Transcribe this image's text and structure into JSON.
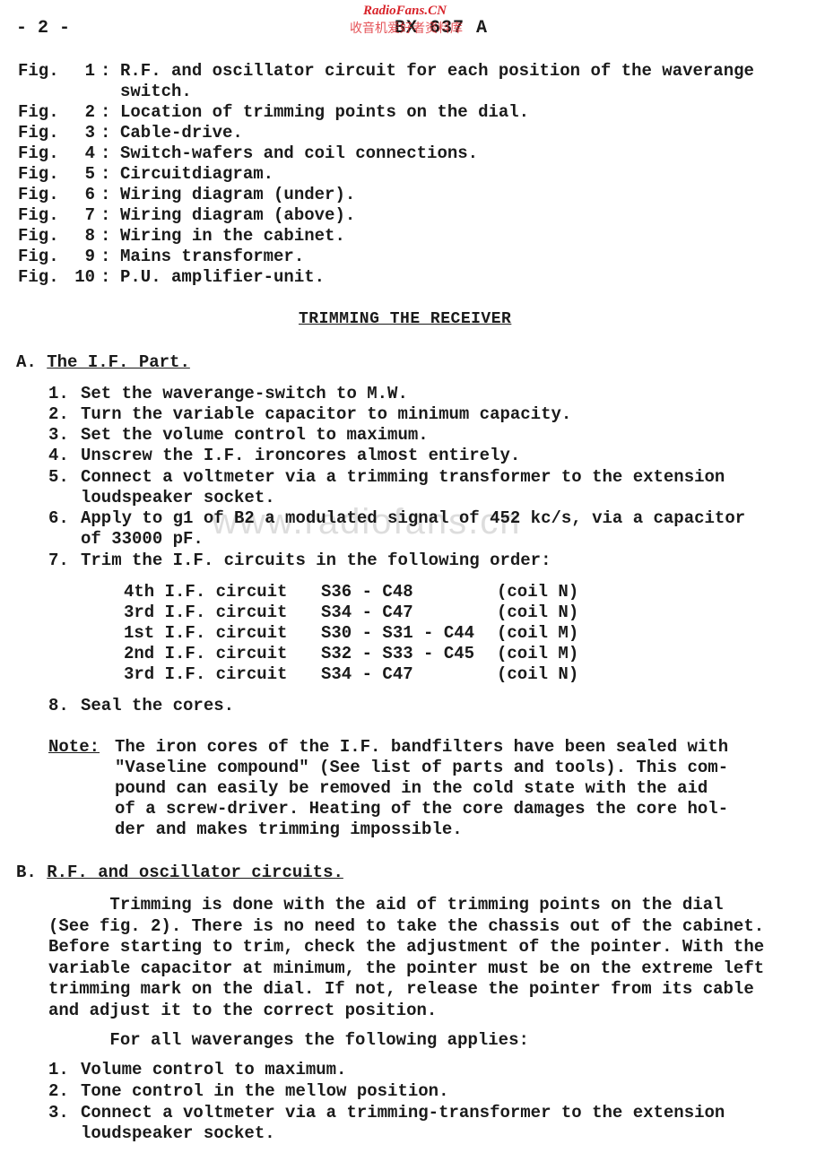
{
  "header": {
    "page_number": "- 2 -",
    "document_code": "BX 637 A",
    "watermark_top": "RadioFans.CN",
    "watermark_cn": "收音机爱好者资料库",
    "watermark_mid": "www.radiofans.cn"
  },
  "figures": [
    {
      "label": "Fig.",
      "num": "1",
      "sep": ":",
      "text": "R.F. and oscillator circuit for each position of the waverange\nswitch."
    },
    {
      "label": "Fig.",
      "num": "2",
      "sep": ":",
      "text": "Location of trimming points on the dial."
    },
    {
      "label": "Fig.",
      "num": "3",
      "sep": ":",
      "text": "Cable-drive."
    },
    {
      "label": "Fig.",
      "num": "4",
      "sep": ":",
      "text": "Switch-wafers and coil connections."
    },
    {
      "label": "Fig.",
      "num": "5",
      "sep": ":",
      "text": "Circuitdiagram."
    },
    {
      "label": "Fig.",
      "num": "6",
      "sep": ":",
      "text": "Wiring diagram (under)."
    },
    {
      "label": "Fig.",
      "num": "7",
      "sep": ":",
      "text": "Wiring diagram (above)."
    },
    {
      "label": "Fig.",
      "num": "8",
      "sep": ":",
      "text": "Wiring in the cabinet."
    },
    {
      "label": "Fig.",
      "num": "9",
      "sep": ":",
      "text": "Mains transformer."
    },
    {
      "label": "Fig.",
      "num": "10",
      "sep": ":",
      "text": "P.U. amplifier-unit."
    }
  ],
  "section_title": "TRIMMING THE RECEIVER",
  "part_a": {
    "letter": "A.",
    "title": "The I.F. Part.",
    "steps": [
      {
        "num": "1.",
        "text": "Set the waverange-switch to M.W."
      },
      {
        "num": "2.",
        "text": "Turn the variable capacitor to minimum capacity."
      },
      {
        "num": "3.",
        "text": "Set the volume control to maximum."
      },
      {
        "num": "4.",
        "text": "Unscrew the I.F. ironcores almost entirely."
      },
      {
        "num": "5.",
        "text": "Connect a voltmeter via a trimming transformer to the extension\nloudspeaker socket."
      },
      {
        "num": "6.",
        "text": "Apply to g1 of B2 a modulated signal of 452 kc/s, via a capacitor\nof 33000 pF."
      },
      {
        "num": "7.",
        "text": "Trim the I.F. circuits in the following order:"
      }
    ],
    "if_table": [
      {
        "circuit": "4th I.F. circuit",
        "parts": "S36 - C48",
        "coil": "(coil N)"
      },
      {
        "circuit": "3rd I.F. circuit",
        "parts": "S34 - C47",
        "coil": "(coil N)"
      },
      {
        "circuit": "1st I.F. circuit",
        "parts": "S30 - S31 - C44",
        "coil": "(coil M)"
      },
      {
        "circuit": "2nd I.F. circuit",
        "parts": "S32 - S33 - C45",
        "coil": "(coil M)"
      },
      {
        "circuit": "3rd I.F. circuit",
        "parts": "S34 - C47",
        "coil": "(coil N)"
      }
    ],
    "step8": {
      "num": "8.",
      "text": "Seal the cores."
    },
    "note": {
      "label": "Note:",
      "text": "The iron cores of the I.F. bandfilters have been sealed with\n\"Vaseline compound\" (See list of parts and tools). This com-\npound can easily be removed in the cold state with the aid\nof a screw-driver. Heating of the core damages the core hol-\nder and makes trimming impossible."
    }
  },
  "part_b": {
    "letter": "B.",
    "title": "R.F. and oscillator circuits.",
    "paragraph": "      Trimming is done with the aid of trimming points on the dial\n(See fig. 2). There is no need to take the chassis out of the cabinet.\nBefore starting to trim, check the adjustment of the pointer. With the\nvariable capacitor at minimum, the pointer must be on the extreme left\ntrimming mark on the dial. If not, release the pointer from its cable\nand adjust it to the correct position.",
    "intro": "      For all waveranges the following applies:",
    "steps": [
      {
        "num": "1.",
        "text": "Volume control to maximum."
      },
      {
        "num": "2.",
        "text": "Tone control in the mellow position."
      },
      {
        "num": "3.",
        "text": "Connect a voltmeter via a trimming-transformer to the extension\nloudspeaker socket."
      }
    ]
  }
}
